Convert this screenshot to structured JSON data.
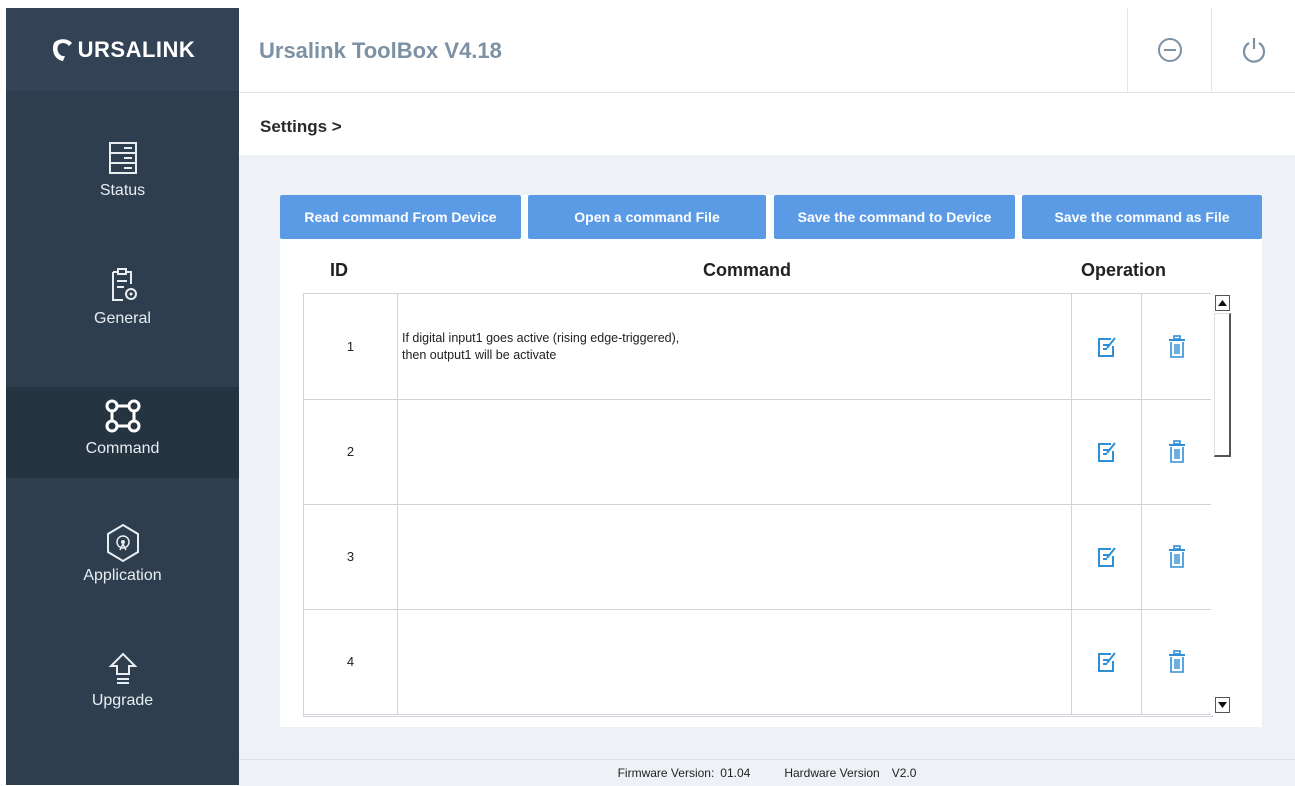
{
  "app": {
    "logo_text": "URSALINK",
    "title": "Ursalink ToolBox V4.18"
  },
  "topbar": {
    "minimize_icon": "minus-circle-icon",
    "power_icon": "power-icon"
  },
  "sidebar": {
    "items": [
      {
        "label": "Status",
        "icon": "status-icon",
        "active": false
      },
      {
        "label": "General",
        "icon": "general-icon",
        "active": false
      },
      {
        "label": "Command",
        "icon": "command-icon",
        "active": true
      },
      {
        "label": "Application",
        "icon": "application-icon",
        "active": false
      },
      {
        "label": "Upgrade",
        "icon": "upgrade-icon",
        "active": false
      }
    ]
  },
  "breadcrumb": "Settings >",
  "buttons": {
    "read": "Read command From Device",
    "open": "Open a command File",
    "save_device": "Save the command to Device",
    "save_file": "Save the command as File"
  },
  "table": {
    "headers": {
      "id": "ID",
      "command": "Command",
      "operation": "Operation"
    },
    "rows": [
      {
        "id": "1",
        "line1": "If digital input1 goes active (rising edge-triggered),",
        "line2": "then output1 will be activate"
      },
      {
        "id": "2",
        "line1": "",
        "line2": ""
      },
      {
        "id": "3",
        "line1": "",
        "line2": ""
      },
      {
        "id": "4",
        "line1": "",
        "line2": ""
      }
    ]
  },
  "footer": {
    "firmware_label": "Firmware Version:",
    "firmware_value": "01.04",
    "hardware_label": "Hardware Version",
    "hardware_value": "V2.0"
  },
  "colors": {
    "sidebar_bg": "#2f3e4f",
    "button_bg": "#5b9be6",
    "icon_blue": "#2e8fd6",
    "title_color": "#7d91a5"
  }
}
